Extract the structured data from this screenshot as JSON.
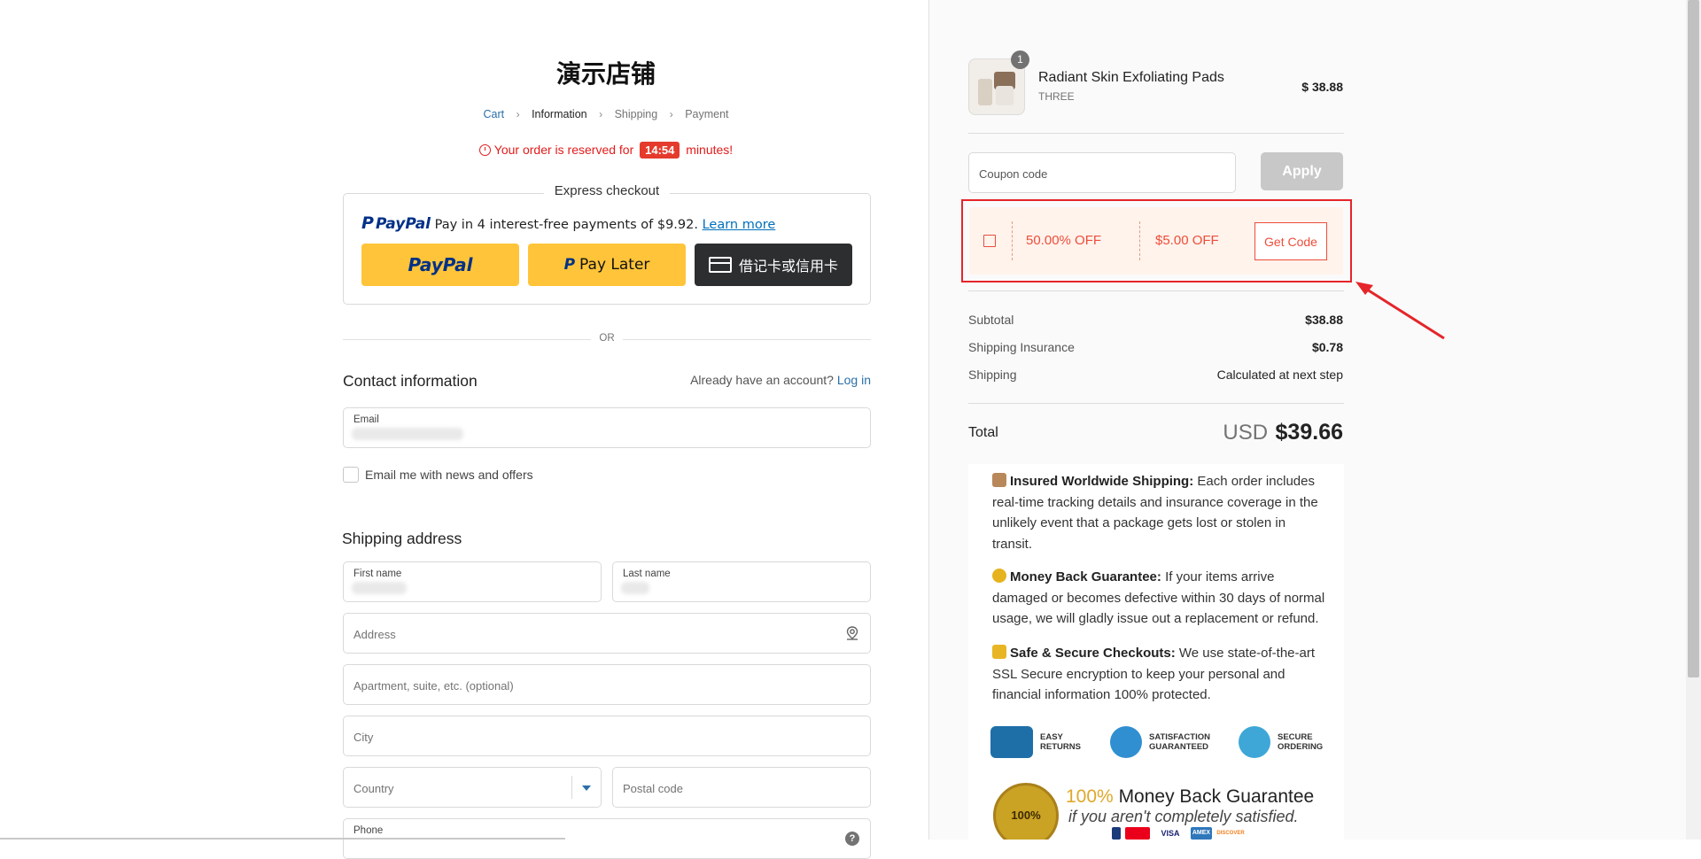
{
  "store": {
    "title": "演示店铺"
  },
  "breadcrumb": {
    "items": [
      "Cart",
      "Information",
      "Shipping",
      "Payment"
    ]
  },
  "reservation": {
    "prefix": "Your order is reserved for",
    "timer": "14:54",
    "suffix": "minutes!"
  },
  "express": {
    "label": "Express checkout",
    "paypal_brand": "PayPal",
    "paypal_text": "Pay in 4 interest-free payments of $9.92.",
    "learn_more": "Learn more",
    "paypal_button": "PayPal",
    "pay_later_button": "Pay Later",
    "card_button": "借记卡或信用卡"
  },
  "divider": {
    "text": "OR"
  },
  "contact": {
    "title": "Contact information",
    "account_prompt": "Already have an account?",
    "login_link": "Log in",
    "email_label": "Email",
    "newsletter_label": "Email me with news and offers"
  },
  "shipping": {
    "title": "Shipping address",
    "first_name_label": "First name",
    "last_name_label": "Last name",
    "address_placeholder": "Address",
    "apartment_placeholder": "Apartment, suite, etc. (optional)",
    "city_placeholder": "City",
    "country_placeholder": "Country",
    "postal_placeholder": "Postal code",
    "phone_label": "Phone"
  },
  "order": {
    "quantity": "1",
    "product_name": "Radiant Skin Exfoliating Pads",
    "variant": "THREE",
    "price": "$ 38.88"
  },
  "coupon": {
    "placeholder": "Coupon code",
    "apply_label": "Apply",
    "offer_percent": "50.00% OFF",
    "offer_amount": "$5.00 OFF",
    "get_code_label": "Get Code"
  },
  "summary": {
    "subtotal_label": "Subtotal",
    "subtotal_value": "$38.88",
    "insurance_label": "Shipping Insurance",
    "insurance_value": "$0.78",
    "shipping_label": "Shipping",
    "shipping_value": "Calculated at next step",
    "total_label": "Total",
    "total_currency": "USD",
    "total_value": "$39.66"
  },
  "guarantees": {
    "shipping_title": "Insured Worldwide Shipping:",
    "shipping_text": "Each order includes real-time tracking details and insurance coverage in the unlikely event that a package gets lost or stolen in transit.",
    "money_title": "Money Back Guarantee:",
    "money_text": "If your items arrive damaged or becomes defective within 30 days of normal usage, we will gladly issue out a replacement or refund.",
    "secure_title": "Safe & Secure Checkouts:",
    "secure_text": "We use state-of-the-art SSL Secure encryption to keep your personal and financial information 100% protected.",
    "badge1": "EASY RETURNS",
    "badge2": "SATISFACTION GUARANTEED",
    "badge3": "SECURE ORDERING",
    "mbg_highlight": "100%",
    "mbg_title": "Money Back Guarantee",
    "mbg_sub": "if you aren't completely satisfied.",
    "seal_text": "100%",
    "card_brands": [
      "VISA",
      "AMEX",
      "DISCOVER"
    ]
  },
  "colors": {
    "accent_red": "#e5252a",
    "paypal_yellow": "#ffc439",
    "link_blue": "#2a6fa8",
    "coupon_orange": "#ee4d3a"
  }
}
